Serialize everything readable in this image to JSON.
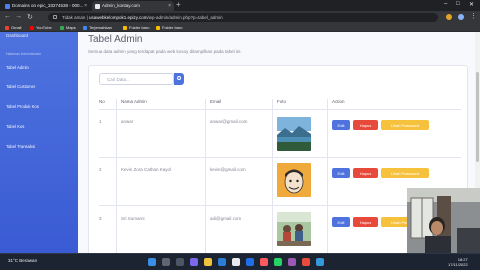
{
  "browser": {
    "tabs": [
      {
        "label": "Domains on epic_33274538 - 000...",
        "active": false
      },
      {
        "label": "Admin_kontay.com",
        "active": true
      }
    ],
    "url_prefix": "Tidak aman | ",
    "url_host": "usawebkelompok1.epizy.com",
    "url_path": "/wp-admin/admin.php?p=tabel_admin",
    "bookmarks": [
      "Gmail",
      "YouTube",
      "Maps",
      "Terjemahkan",
      "Folder baru",
      "Folder baru"
    ]
  },
  "sidebar": {
    "brand": "Dashboard",
    "heading": "Halaman Administrator",
    "items": [
      "Tabel Admin",
      "Tabel Customer",
      "Tabel Produk Kos",
      "Tabel Kos",
      "Tabel Transaksi"
    ]
  },
  "main": {
    "title": "Tabel Admin",
    "description": "Semua data admin yang terdapat pada web kosoy ditampilkan pada tabel ini.",
    "search_placeholder": "Cari Data...",
    "columns": [
      "No",
      "Nama Admin",
      "Email",
      "Foto",
      "Action"
    ],
    "rows": [
      {
        "no": "1",
        "name": "anwar",
        "email": "anwar@gmail.com",
        "photo": "mountain-lake"
      },
      {
        "no": "2",
        "name": "Kevin Zora Cathan Kayol",
        "email": "kevin@gmail.com",
        "photo": "cartoon-face"
      },
      {
        "no": "3",
        "name": "Sri Sumarni",
        "email": "adi@gmail.com",
        "photo": "people-outdoor"
      }
    ],
    "actions": {
      "edit": "Edit",
      "delete": "Hapus",
      "change_password": "Ubah Password"
    }
  },
  "taskbar": {
    "weather": "31°C Berawan",
    "time": "18:27",
    "date": "17/11/2022"
  },
  "colors": {
    "sidebar": "#4e73df",
    "edit": "#4e73df",
    "delete": "#e74a3b",
    "password": "#f6c23e"
  }
}
